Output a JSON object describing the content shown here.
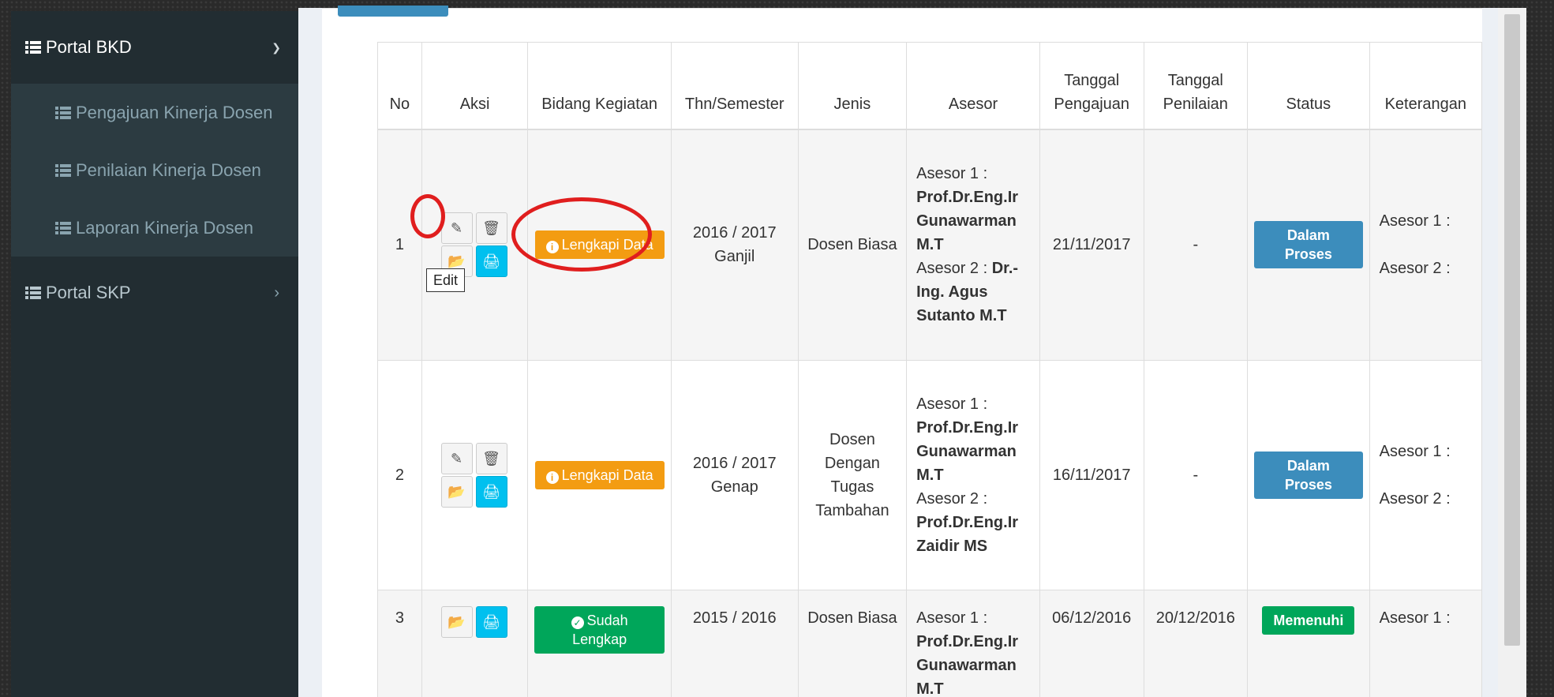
{
  "sidebar": {
    "portal_bkd": "Portal BKD",
    "sub_items": [
      "Pengajuan Kinerja Dosen",
      "Penilaian Kinerja Dosen",
      "Laporan Kinerja Dosen"
    ],
    "portal_skp": "Portal SKP",
    "icons": {
      "menu": "list-icon",
      "expand": "chevron-down-icon",
      "collapsed": "chevron-right-icon"
    }
  },
  "table": {
    "headers": [
      "No",
      "Aksi",
      "Bidang Kegiatan",
      "Thn/Semester",
      "Jenis",
      "Asesor",
      "Tanggal Pengajuan",
      "Tanggal Penilaian",
      "Status",
      "Keterangan"
    ],
    "rows": [
      {
        "no": "1",
        "bidang": "Lengkapi Data",
        "semester_year": "2016 / 2017",
        "semester_term": "Ganjil",
        "jenis": "Dosen Biasa",
        "asesor1_label": "Asesor 1 :",
        "asesor1_name": "Prof.Dr.Eng.Ir Gunawarman M.T",
        "asesor2_label": "Asesor 2 :",
        "asesor2_name": "Dr.-Ing. Agus Sutanto M.T",
        "tgl_pengajuan": "21/11/2017",
        "tgl_penilaian": "-",
        "status": "Dalam Proses",
        "ket1": "Asesor 1 :",
        "ket2": "Asesor 2 :"
      },
      {
        "no": "2",
        "bidang": "Lengkapi Data",
        "semester_year": "2016 / 2017",
        "semester_term": "Genap",
        "jenis": "Dosen Dengan Tugas Tambahan",
        "asesor1_label": "Asesor 1 :",
        "asesor1_name": "Prof.Dr.Eng.Ir Gunawarman M.T",
        "asesor2_label": "Asesor 2 :",
        "asesor2_name": "Prof.Dr.Eng.Ir Zaidir MS",
        "tgl_pengajuan": "16/11/2017",
        "tgl_penilaian": "-",
        "status": "Dalam Proses",
        "ket1": "Asesor 1 :",
        "ket2": "Asesor 2 :"
      },
      {
        "no": "3",
        "bidang": "Sudah Lengkap",
        "semester_year": "2015 / 2016",
        "jenis": "Dosen Biasa",
        "asesor1_label": "Asesor 1 :",
        "asesor1_name": "Prof.Dr.Eng.Ir Gunawarman M.T",
        "tgl_pengajuan": "06/12/2016",
        "tgl_penilaian": "20/12/2016",
        "status": "Memenuhi",
        "ket1": "Asesor 1 :"
      }
    ]
  },
  "tooltip": "Edit",
  "action_icons": [
    "edit-icon",
    "trash-icon",
    "folder-icon",
    "print-icon"
  ],
  "colors": {
    "warning": "#f39c12",
    "success": "#00a65a",
    "primary": "#3c8dbc",
    "info": "#00c0ef",
    "highlight": "#e01e1e"
  }
}
